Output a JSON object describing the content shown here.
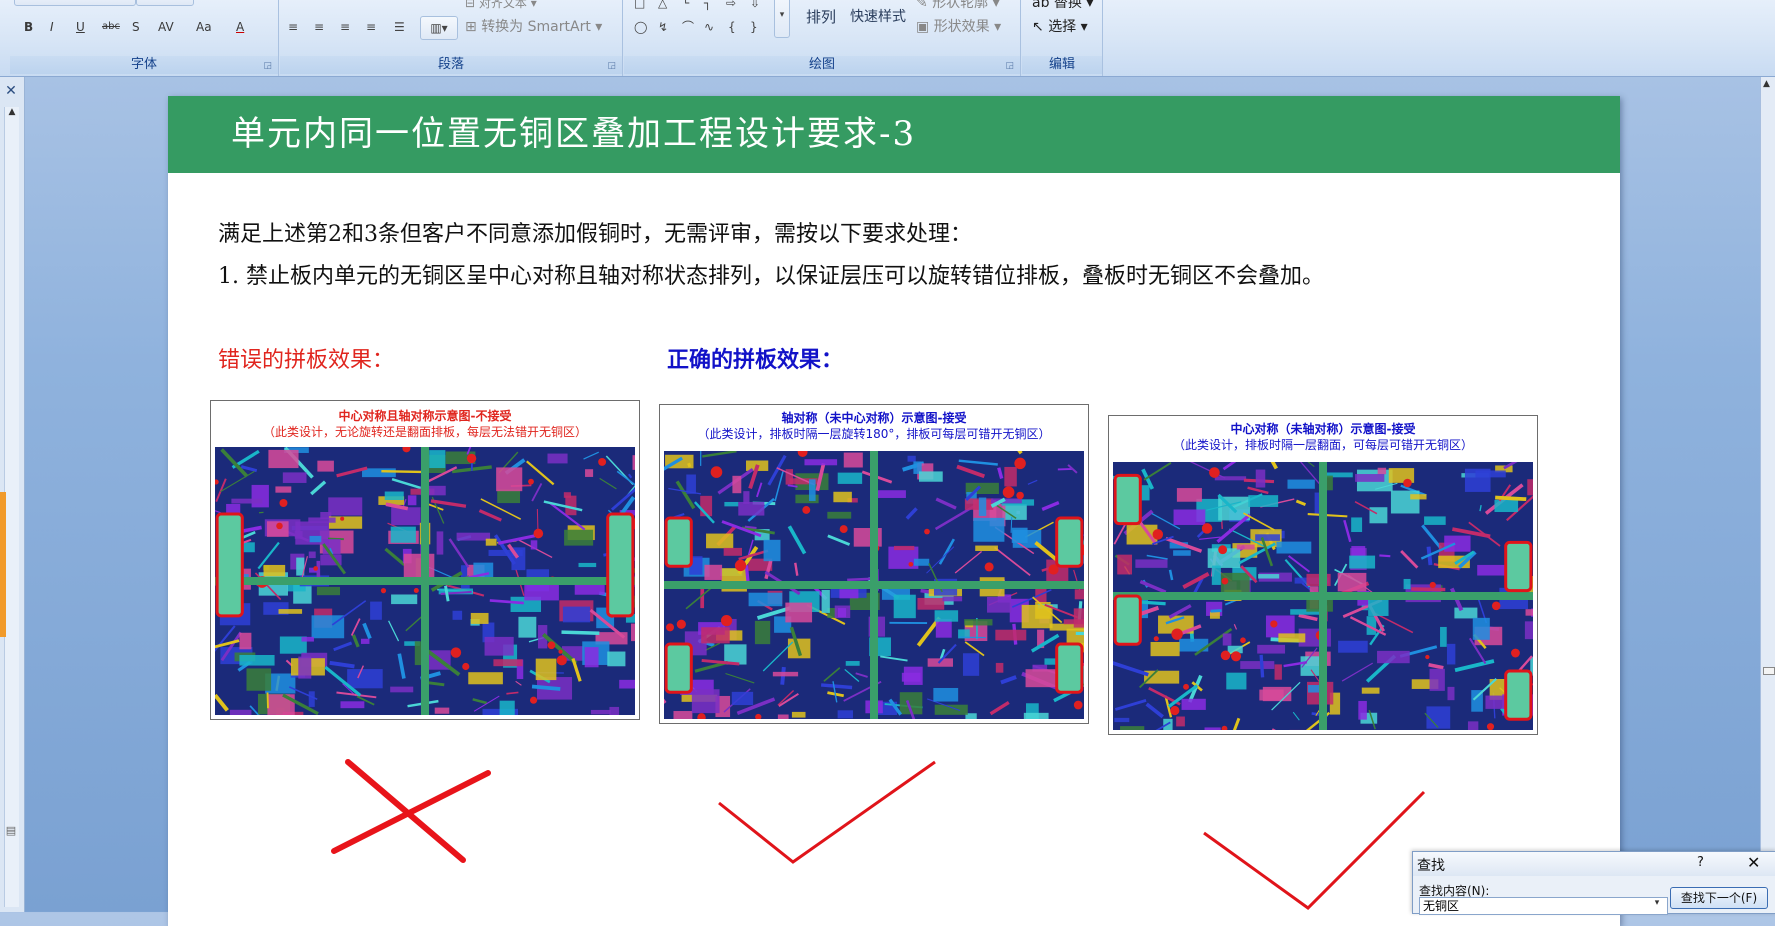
{
  "ribbon": {
    "groups": {
      "font": "字体",
      "paragraph": "段落",
      "drawing": "绘图",
      "editing": "编辑"
    },
    "font_buttons": [
      "B",
      "I",
      "U",
      "abc",
      "S",
      "AV",
      "Aa",
      "A"
    ],
    "align_text": "对齐文本",
    "convert_smartart": "转换为 SmartArt",
    "arrange": "排列",
    "quick_styles": "快速样式",
    "shape_outline": "形状轮廓",
    "shape_effects": "形状效果",
    "replace": "替换",
    "select": "选择",
    "shapes_row1": [
      "□",
      "△",
      "└",
      "┐",
      "⇨",
      "⇩"
    ],
    "shapes_row2": [
      "◯",
      "↯",
      "⌒",
      "∿",
      "{",
      "}"
    ]
  },
  "slide": {
    "title": "单元内同一位置无铜区叠加工程设计要求-3",
    "line1": "满足上述第2和3条但客户不同意添加假铜时，无需评审，需按以下要求处理：",
    "line2": "1. 禁止板内单元的无铜区呈中心对称且轴对称状态排列，以保证层压可以旋转错位排板，叠板时无铜区不会叠加。",
    "wrong_label": "错误的拼板效果：",
    "right_label": "正确的拼板效果：",
    "panels": [
      {
        "title": "中心对称且轴对称示意图-不接受",
        "subtitle": "（此类设计，无论旋转还是翻面排板，每层无法错开无铜区）",
        "color": "#e0251e"
      },
      {
        "title": "轴对称（未中心对称）示意图-接受",
        "subtitle": "（此类设计，排板时隔一层旋转180°，排板可每层可错开无铜区）",
        "color": "#1212c8"
      },
      {
        "title": "中心对称（未轴对称）示意图-接受",
        "subtitle": "（此类设计，排板时隔一层翻面，可每层可错开无铜区）",
        "color": "#1212c8"
      }
    ],
    "marks": [
      "cross-mark",
      "check-mark",
      "check-mark"
    ]
  },
  "find_dialog": {
    "title": "查找",
    "help": "?",
    "close": "✕",
    "label": "查找内容(N):",
    "value": "无铜区",
    "find_next": "查找下一个(F)"
  },
  "colors": {
    "title_bar": "#359b62",
    "wrong": "#e0251e",
    "right": "#1212c8",
    "check": "#e0141a",
    "copper_free": "#5cc9a0"
  }
}
